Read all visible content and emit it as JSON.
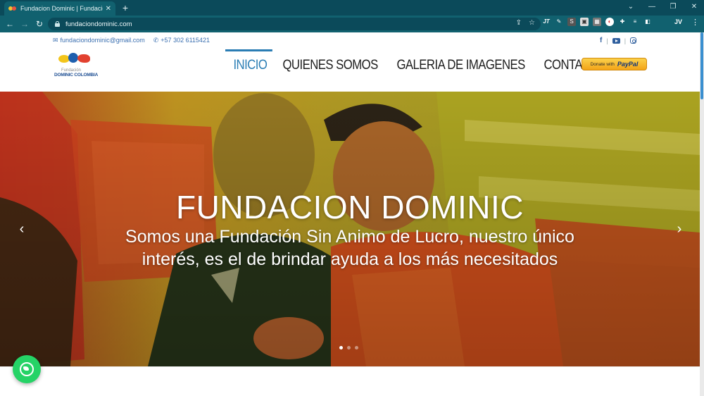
{
  "browser": {
    "tab_title": "Fundacion Dominic | Fundación",
    "tab_close": "✕",
    "new_tab": "+",
    "url": "fundaciondominic.com",
    "profile_initials": "JV",
    "window_controls": [
      "⌄",
      "—",
      "❐",
      "✕"
    ],
    "nav": {
      "back": "←",
      "forward": "→",
      "reload": "↻"
    },
    "menu": "⋮",
    "extensions": [
      "jt-icon",
      "bookmark-ext-icon",
      "s-ext-icon",
      "screenshot-ext-icon",
      "ext-5-icon",
      "chrome-icon",
      "puzzle-icon",
      "reading-list-icon",
      "sidebar-icon"
    ]
  },
  "header": {
    "email": "fundaciondominic@gmail.com",
    "phone": "+57 302 6115421",
    "logo": {
      "small_text": "Fundación",
      "name": "DOMINIC COLOMBIA"
    },
    "nav": [
      {
        "label": "INICIO",
        "active": true
      },
      {
        "label": "QUIENES SOMOS",
        "active": false
      },
      {
        "label": "GALERIA DE IMAGENES",
        "active": false
      },
      {
        "label": "CONTACTO",
        "active": false
      }
    ],
    "paypal": {
      "donate": "Donate with",
      "brand": "PayPal"
    },
    "social": [
      "facebook-icon",
      "youtube-icon",
      "instagram-icon"
    ]
  },
  "hero": {
    "title": "FUNDACION DOMINIC",
    "subtitle": "Somos una Fundación Sin Animo de Lucro, nuestro único interés, es el de brindar ayuda a los más necesitados",
    "prev": "‹",
    "next": "›",
    "slides": 3,
    "active_slide": 1
  },
  "colors": {
    "browser_dark": "#0b4a5a",
    "browser_toolbar": "#11616f",
    "accent": "#2a7db4",
    "whatsapp": "#25d366"
  }
}
